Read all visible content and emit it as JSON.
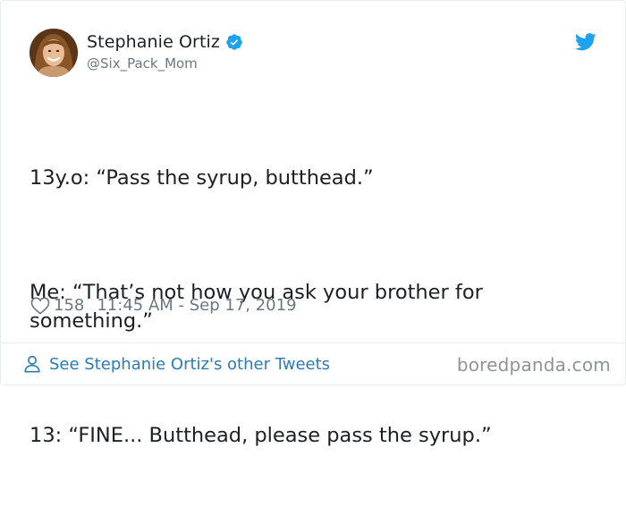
{
  "user": {
    "display_name": "Stephanie Ortiz",
    "handle": "@Six_Pack_Mom",
    "verified": true
  },
  "tweet": {
    "lines": [
      "13y.o: “Pass the syrup, butthead.”",
      "Me: “That’s not how you ask your brother for something.”",
      "13: “FINE... Butthead, please pass the syrup.”"
    ],
    "likes": "158",
    "timestamp": "11:45 AM - Sep 17, 2019"
  },
  "footer": {
    "other_tweets_label": "See Stephanie Ortiz's other Tweets",
    "watermark": "boredpanda.com"
  },
  "icons": {
    "verified": "verified-badge-icon",
    "bird": "twitter-bird-icon",
    "heart": "heart-icon",
    "person": "person-icon"
  },
  "colors": {
    "twitter_blue": "#1da1f2",
    "link_blue": "#2b7bb9",
    "muted_text": "#697882",
    "body_text": "#1c2022"
  }
}
